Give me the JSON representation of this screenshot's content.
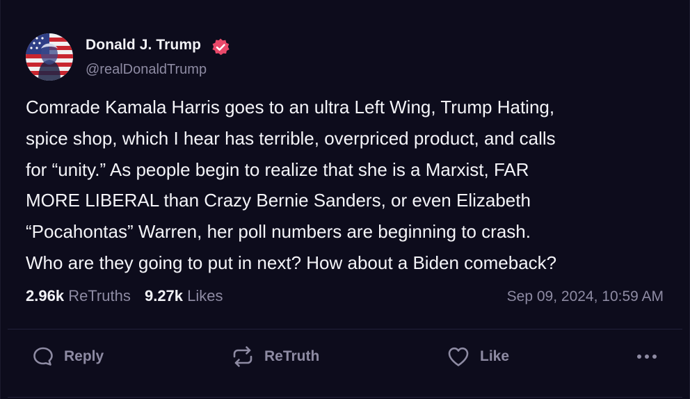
{
  "author": {
    "name": "Donald J. Trump",
    "handle": "@realDonaldTrump",
    "verified_badge_color": "#e9496a",
    "avatar": "flag-portrait-avatar"
  },
  "post": {
    "text": "Comrade Kamala Harris goes to an ultra Left Wing, Trump Hating,\nspice shop, which I hear has terrible, overpriced product, and calls\nfor “unity.” As people begin to realize that she is a Marxist, FAR\nMORE LIBERAL than Crazy Bernie Sanders, or even Elizabeth\n“Pocahontas” Warren, her poll numbers are beginning to crash.\nWho are they going to put in next? How about a Biden comeback?"
  },
  "stats": {
    "retruths_count": "2.96k",
    "retruths_label": "ReTruths",
    "likes_count": "9.27k",
    "likes_label": "Likes",
    "timestamp": "Sep 09, 2024, 10:59 AM"
  },
  "actions": {
    "reply_label": "Reply",
    "reply_icon": "speech-bubble-icon",
    "retruth_label": "ReTruth",
    "retruth_icon": "repost-arrows-icon",
    "like_label": "Like",
    "like_icon": "heart-icon",
    "more_icon": "ellipsis-icon"
  },
  "colors": {
    "background": "#0d0c1c",
    "text_primary": "#f4f4f8",
    "text_secondary": "#8e8ba3",
    "divider": "#22213a"
  }
}
